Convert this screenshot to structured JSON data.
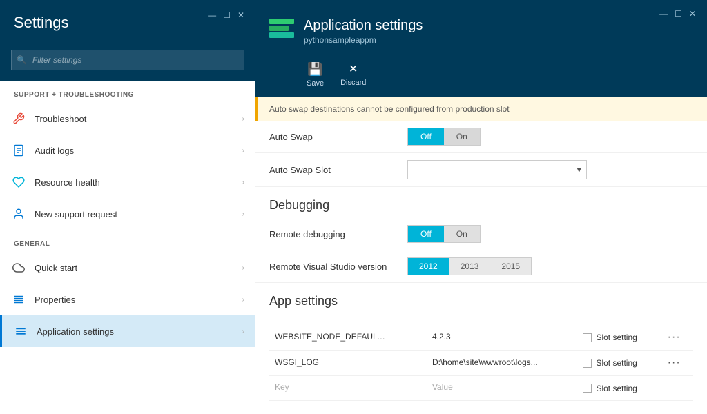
{
  "leftPanel": {
    "title": "Settings",
    "windowControls": [
      "—",
      "☐",
      "✕"
    ],
    "search": {
      "placeholder": "Filter settings"
    },
    "sections": [
      {
        "label": "SUPPORT + TROUBLESHOOTING",
        "items": [
          {
            "id": "troubleshoot",
            "label": "Troubleshoot",
            "icon": "wrench"
          },
          {
            "id": "audit-logs",
            "label": "Audit logs",
            "icon": "document"
          },
          {
            "id": "resource-health",
            "label": "Resource health",
            "icon": "heart"
          },
          {
            "id": "new-support-request",
            "label": "New support request",
            "icon": "person"
          }
        ]
      },
      {
        "label": "GENERAL",
        "items": [
          {
            "id": "quick-start",
            "label": "Quick start",
            "icon": "cloud"
          },
          {
            "id": "properties",
            "label": "Properties",
            "icon": "bars"
          },
          {
            "id": "application-settings",
            "label": "Application settings",
            "icon": "bars-equal",
            "active": true
          }
        ]
      }
    ]
  },
  "rightPanel": {
    "title": "Application settings",
    "subtitle": "pythonsampleappm",
    "windowControls": [
      "—",
      "☐",
      "✕"
    ],
    "toolbar": [
      {
        "id": "save",
        "icon": "💾",
        "label": "Save"
      },
      {
        "id": "discard",
        "icon": "✕",
        "label": "Discard"
      }
    ],
    "alertBar": "Auto swap destinations cannot be configured from production slot",
    "autoSwap": {
      "label": "Auto Swap",
      "offLabel": "Off",
      "onLabel": "On",
      "activeState": "off"
    },
    "autoSwapSlot": {
      "label": "Auto Swap Slot",
      "options": []
    },
    "debugging": {
      "heading": "Debugging",
      "remoteDebugging": {
        "label": "Remote debugging",
        "offLabel": "Off",
        "onLabel": "On",
        "activeState": "off"
      },
      "remoteVisualStudio": {
        "label": "Remote Visual Studio version",
        "versions": [
          "2012",
          "2013",
          "2015"
        ],
        "activeVersion": "2012"
      }
    },
    "appSettings": {
      "heading": "App settings",
      "rows": [
        {
          "key": "WEBSITE_NODE_DEFAULT_V...",
          "value": "4.2.3",
          "slotSetting": "Slot setting"
        },
        {
          "key": "WSGI_LOG",
          "value": "D:\\home\\site\\wwwroot\\logs...",
          "slotSetting": "Slot setting"
        },
        {
          "key": "Key",
          "value": "Value",
          "slotSetting": "Slot setting"
        }
      ]
    }
  }
}
